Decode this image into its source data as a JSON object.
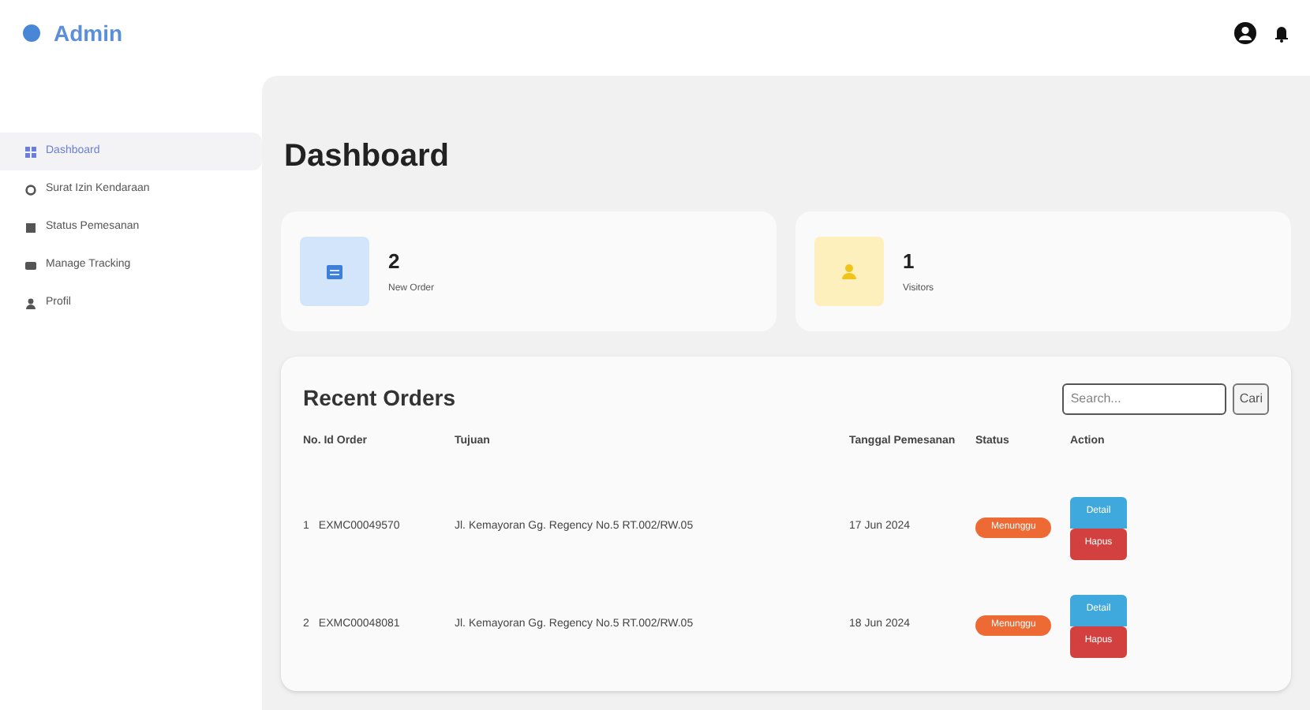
{
  "brand": "Admin",
  "sidebar": {
    "items": [
      {
        "label": "Dashboard",
        "kind": "grid",
        "selected": true
      },
      {
        "label": "Surat Izin Kendaraan",
        "kind": "circle",
        "selected": false
      },
      {
        "label": "Status Pemesanan",
        "kind": "square",
        "selected": false
      },
      {
        "label": "Manage Tracking",
        "kind": "card",
        "selected": false
      },
      {
        "label": "Profil",
        "kind": "person",
        "selected": false
      }
    ]
  },
  "page_title": "Dashboard",
  "stats": [
    {
      "value": "2",
      "label": "New Order",
      "kind": "calendar"
    },
    {
      "value": "1",
      "label": "Visitors",
      "kind": "person"
    }
  ],
  "orders": {
    "title": "Recent Orders",
    "search": {
      "placeholder": "Search..."
    },
    "search_button": "Cari",
    "columns": [
      "No. Id Order",
      "Tujuan",
      "Tanggal Pemesanan",
      "Status",
      "Action"
    ],
    "rows": [
      {
        "no": "1",
        "id": "EXMC00049570",
        "tujuan": "Jl. Kemayoran Gg. Regency No.5 RT.002/RW.05",
        "tanggal": "17 Jun 2024",
        "status": "Menunggu",
        "actions": [
          "Detail",
          "Hapus"
        ]
      },
      {
        "no": "2",
        "id": "EXMC00048081",
        "tujuan": "Jl. Kemayoran Gg. Regency No.5 RT.002/RW.05",
        "tanggal": "18 Jun 2024",
        "status": "Menunggu",
        "actions": [
          "Detail",
          "Hapus"
        ]
      }
    ]
  }
}
